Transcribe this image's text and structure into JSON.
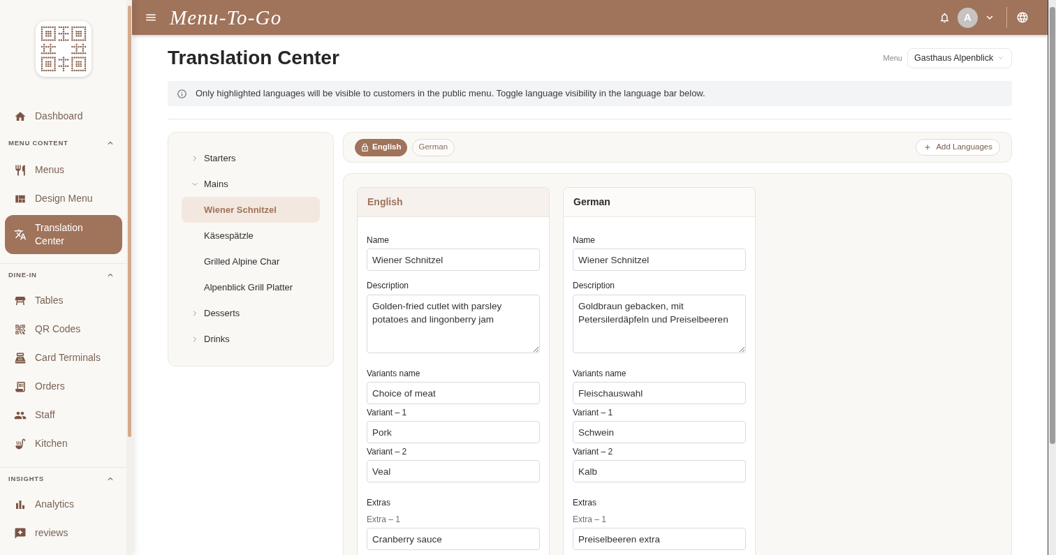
{
  "sidebar": {
    "items": [
      {
        "label": "Dashboard",
        "selected": false
      }
    ],
    "sections": [
      {
        "title": "MENU CONTENT",
        "expanded": true,
        "items": [
          {
            "label": "Menus",
            "selected": false
          },
          {
            "label": "Design Menu",
            "selected": false
          },
          {
            "label": "Translation Center",
            "selected": true
          }
        ]
      },
      {
        "title": "DINE-IN",
        "expanded": true,
        "items": [
          {
            "label": "Tables",
            "selected": false
          },
          {
            "label": "QR Codes",
            "selected": false
          },
          {
            "label": "Card Terminals",
            "selected": false
          },
          {
            "label": "Orders",
            "selected": false
          },
          {
            "label": "Staff",
            "selected": false
          },
          {
            "label": "Kitchen",
            "selected": false
          }
        ]
      },
      {
        "title": "INSIGHTS",
        "expanded": true,
        "items": [
          {
            "label": "Analytics",
            "selected": false
          },
          {
            "label": "reviews",
            "selected": false
          }
        ]
      }
    ]
  },
  "header": {
    "logo": "Menu-To-Go",
    "avatar": "A"
  },
  "page": {
    "title": "Translation Center",
    "menu_label": "Menu",
    "menu_value": "Gasthaus Alpenblick",
    "notice": "Only highlighted languages will be visible to customers in the public menu. Toggle language visibility in the language bar below."
  },
  "tree": [
    {
      "label": "Starters",
      "expanded": false
    },
    {
      "label": "Mains",
      "expanded": true,
      "children": [
        {
          "label": "Wiener Schnitzel",
          "selected": true
        },
        {
          "label": "Käsespätzle",
          "selected": false
        },
        {
          "label": "Grilled Alpine Char",
          "selected": false
        },
        {
          "label": "Alpenblick Grill Platter",
          "selected": false
        }
      ]
    },
    {
      "label": "Desserts",
      "expanded": false
    },
    {
      "label": "Drinks",
      "expanded": false
    }
  ],
  "languages": {
    "pills": [
      {
        "label": "English",
        "highlighted": true,
        "locked": true
      },
      {
        "label": "German",
        "highlighted": false,
        "locked": false
      }
    ],
    "add_button": "Add Languages"
  },
  "columns": [
    {
      "language": "English",
      "base": true,
      "fields": [
        {
          "kind": "text",
          "label": "Name",
          "value": "Wiener Schnitzel"
        },
        {
          "kind": "textarea",
          "label": "Description",
          "value": "Golden-fried cutlet with parsley potatoes and lingonberry jam"
        },
        {
          "kind": "group",
          "label": "Variants name",
          "value": "Choice of meat"
        },
        {
          "kind": "option",
          "label": "Variant – 1",
          "value": "Pork"
        },
        {
          "kind": "option",
          "label": "Variant – 2",
          "value": "Veal"
        },
        {
          "kind": "heading",
          "label": "Extras"
        },
        {
          "kind": "extra",
          "label": "Extra – 1",
          "value": "Cranberry sauce"
        }
      ]
    },
    {
      "language": "German",
      "base": false,
      "fields": [
        {
          "kind": "text",
          "label": "Name",
          "value": "Wiener Schnitzel"
        },
        {
          "kind": "textarea",
          "label": "Description",
          "value": "Goldbraun gebacken, mit Petersilerdäpfeln und Preiselbeeren"
        },
        {
          "kind": "group",
          "label": "Variants name",
          "value": "Fleischauswahl"
        },
        {
          "kind": "option",
          "label": "Variant – 1",
          "value": "Schwein"
        },
        {
          "kind": "option",
          "label": "Variant – 2",
          "value": "Kalb"
        },
        {
          "kind": "heading",
          "label": "Extras"
        },
        {
          "kind": "extra",
          "label": "Extra – 1",
          "value": "Preiselbeeren extra"
        }
      ]
    }
  ]
}
